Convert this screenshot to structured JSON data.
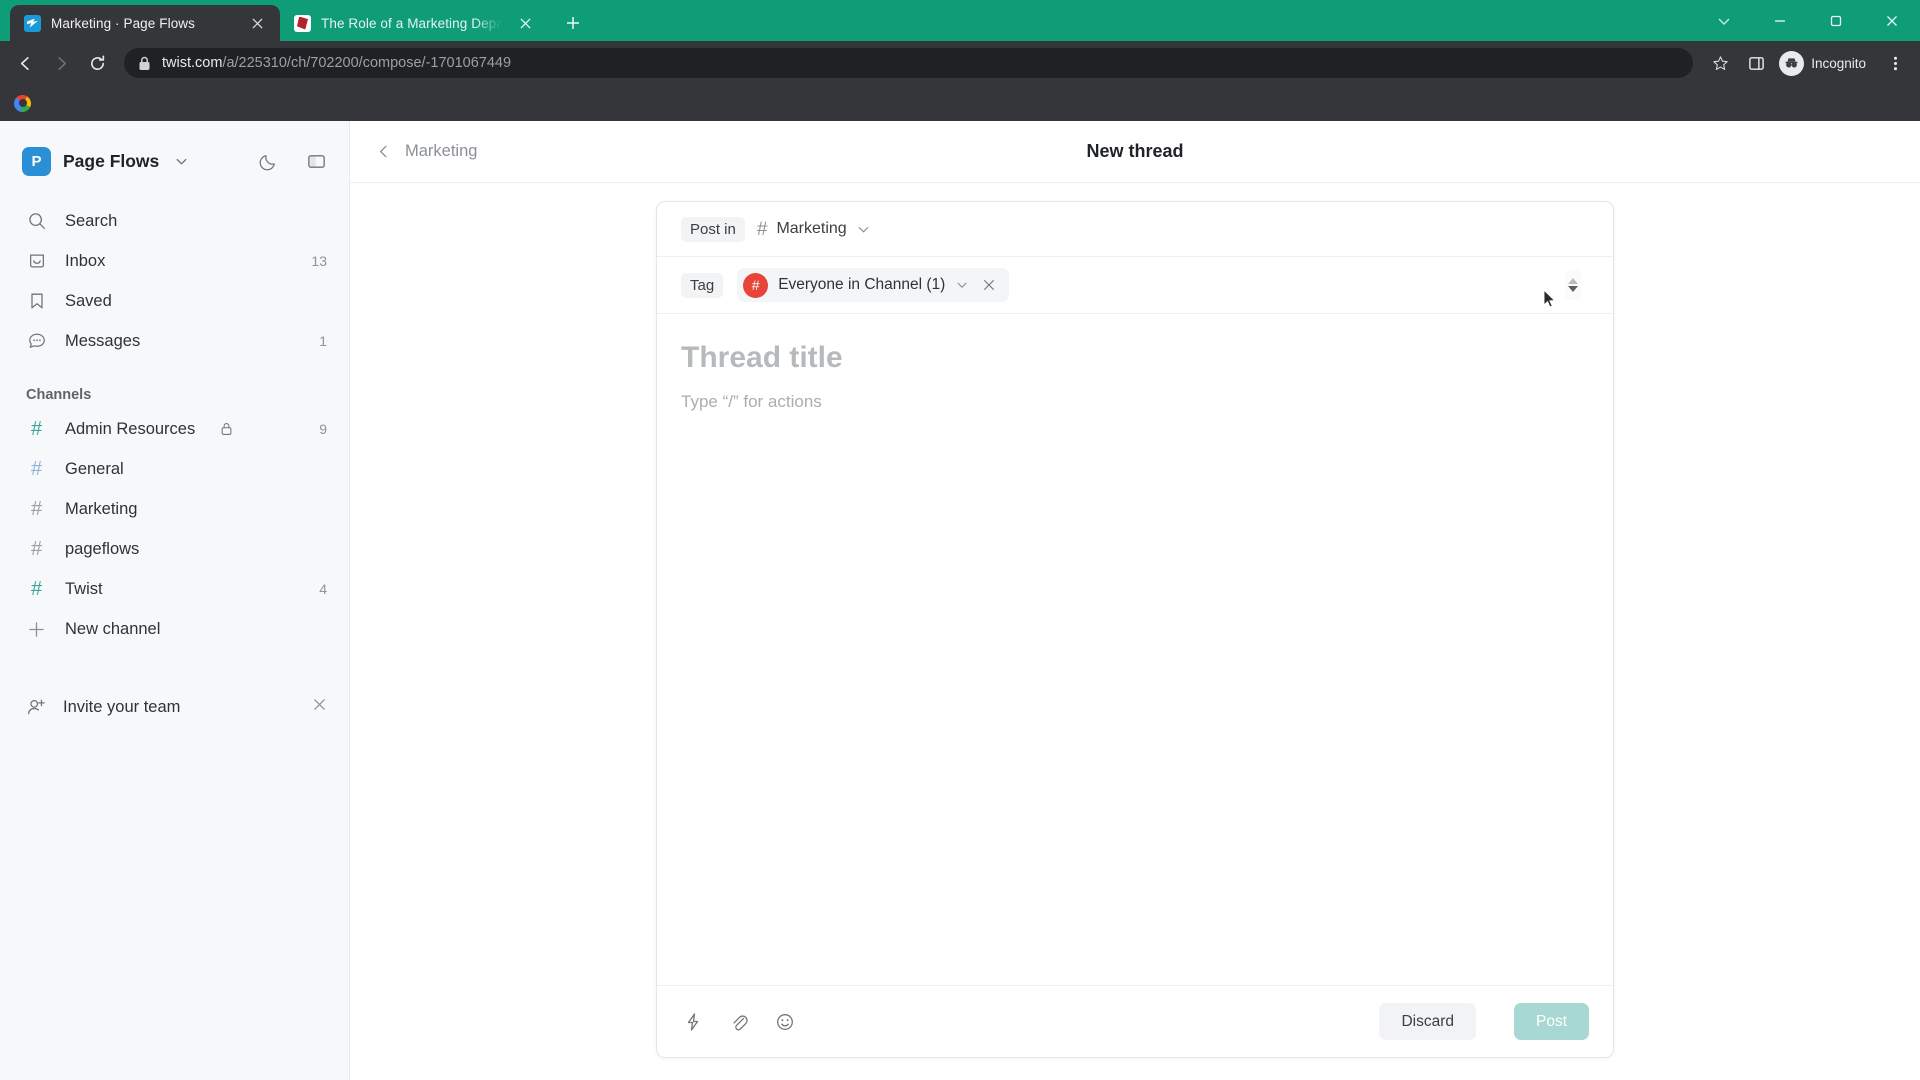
{
  "browser": {
    "tabs": [
      {
        "title": "Marketing · Page Flows",
        "favicon": "twist-icon",
        "active": true
      },
      {
        "title": "The Role of a Marketing Departm",
        "favicon": "document-icon",
        "active": false
      }
    ],
    "new_tab_label": "+",
    "window_controls": [
      "tab-search-chevron",
      "minimize",
      "maximize",
      "close"
    ],
    "address": {
      "domain": "twist.com",
      "path": "/a/225310/ch/702200/compose/-1701067449",
      "lock": "lock-icon"
    },
    "profile_label": "Incognito",
    "accent_color": "#0f9d77",
    "chrome_bg": "#35363a"
  },
  "sidebar": {
    "workspace": {
      "initial": "P",
      "name": "Page Flows",
      "logo_color": "#2b8fd6"
    },
    "header_icons": [
      {
        "name": "dark-mode-toggle",
        "icon": "moon-icon"
      },
      {
        "name": "panel-toggle",
        "icon": "sidebar-panel-icon"
      }
    ],
    "nav": [
      {
        "label": "Search",
        "icon": "search-icon",
        "badge": ""
      },
      {
        "label": "Inbox",
        "icon": "inbox-icon",
        "badge": "13"
      },
      {
        "label": "Saved",
        "icon": "bookmark-icon",
        "badge": ""
      },
      {
        "label": "Messages",
        "icon": "chat-bubble-icon",
        "badge": "1"
      }
    ],
    "channels_title": "Channels",
    "channels": [
      {
        "label": "Admin Resources",
        "badge": "9",
        "private": true,
        "hash_color": "#3aa99a"
      },
      {
        "label": "General",
        "badge": "",
        "private": false,
        "hash_color": "#8fb4d8"
      },
      {
        "label": "Marketing",
        "badge": "",
        "private": false,
        "hash_color": "#9aa0a6"
      },
      {
        "label": "pageflows",
        "badge": "",
        "private": false,
        "hash_color": "#9aa0a6"
      },
      {
        "label": "Twist",
        "badge": "4",
        "private": false,
        "hash_color": "#3aa99a"
      }
    ],
    "new_channel_label": "New channel",
    "invite": {
      "label": "Invite your team",
      "icon": "add-person-icon",
      "close": "close-icon"
    }
  },
  "main": {
    "back_label": "Marketing",
    "title": "New thread"
  },
  "composer": {
    "post_in_label": "Post in",
    "channel": "Marketing",
    "tag_label": "Tag",
    "tag_value": "Everyone in Channel (1)",
    "tag_avatar_glyph": "#",
    "tag_avatar_color": "#e8443a",
    "title_placeholder": "Thread title",
    "body_placeholder": "Type “/” for actions",
    "footer_icons": [
      {
        "name": "lightning-icon"
      },
      {
        "name": "attachment-icon"
      },
      {
        "name": "emoji-icon"
      }
    ],
    "discard_label": "Discard",
    "post_label": "Post",
    "post_button_color": "#a8d8d4"
  }
}
